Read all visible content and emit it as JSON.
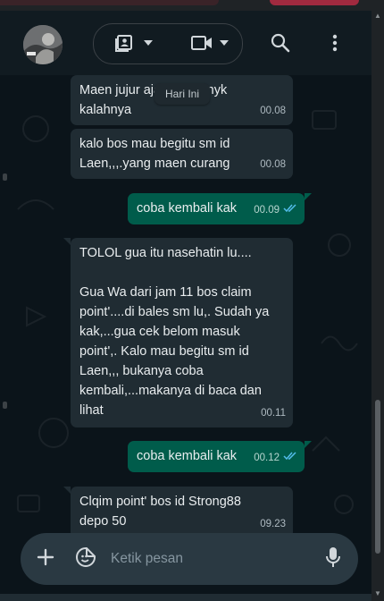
{
  "header": {
    "avatar_icon": "contact-avatar-icon",
    "gallery_icon": "media-gallery-icon",
    "video_icon": "video-call-icon",
    "search_icon": "search-icon",
    "menu_icon": "more-vert-icon"
  },
  "chat": {
    "date_chip": "Hari Ini",
    "messages": [
      {
        "direction": "in",
        "text": "Maen jujur aja, bos gonyk\nkalahnya",
        "time": "00.08"
      },
      {
        "direction": "in",
        "text": "kalo bos mau begitu sm id\nLaen,,,.yang maen curang",
        "time": "00.08"
      },
      {
        "direction": "out",
        "text": "coba kembali kak",
        "time": "00.09",
        "status": "read"
      },
      {
        "direction": "in",
        "text": "TOLOL gua itu nasehatin lu....\n\nGua Wa dari jam 11 bos claim\npoint'....di bales sm lu,. Sudah ya\nkak,...gua cek belom masuk\npoint',. Kalo mau begitu sm id\nLaen,,, bukanya coba\nkembali,...makanya di baca dan\nlihat",
        "time": "00.11"
      },
      {
        "direction": "out",
        "text": "coba kembali kak",
        "time": "00.12",
        "status": "read"
      },
      {
        "direction": "in",
        "text": "Clqim point' bos id Strong88\ndepo 50",
        "time": "09.23"
      }
    ]
  },
  "composer": {
    "placeholder": "Ketik pesan",
    "add_icon": "plus-icon",
    "sticker_icon": "sticker-icon",
    "mic_icon": "microphone-icon"
  },
  "colors": {
    "header_bg": "#111b21",
    "chat_bg": "#0b141a",
    "incoming_bubble": "#202c33",
    "outgoing_bubble": "#005c4b",
    "read_ticks": "#53bdeb"
  }
}
